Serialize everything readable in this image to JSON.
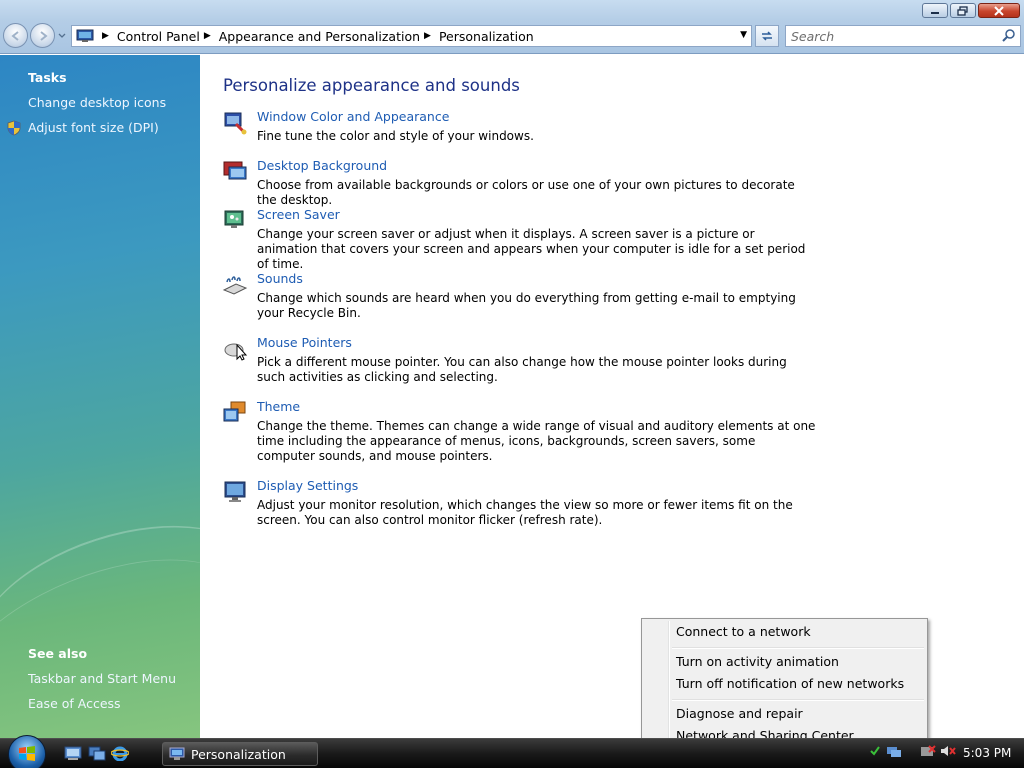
{
  "window": {
    "title": "Personalization"
  },
  "address_bar": {
    "breadcrumbs": [
      "Control Panel",
      "Appearance and Personalization",
      "Personalization"
    ]
  },
  "search": {
    "placeholder": "Search"
  },
  "sidebar": {
    "tasks_heading": "Tasks",
    "tasks": [
      "Change desktop icons",
      "Adjust font size (DPI)"
    ],
    "see_also_heading": "See also",
    "see_also": [
      "Taskbar and Start Menu",
      "Ease of Access"
    ]
  },
  "main": {
    "title": "Personalize appearance and sounds",
    "items": [
      {
        "icon": "window-color-icon",
        "link": "Window Color and Appearance",
        "desc": "Fine tune the color and style of your windows."
      },
      {
        "icon": "desktop-background-icon",
        "link": "Desktop Background",
        "desc": "Choose from available backgrounds or colors or use one of your own pictures to decorate the desktop."
      },
      {
        "icon": "screen-saver-icon",
        "link": "Screen Saver",
        "desc": "Change your screen saver or adjust when it displays. A screen saver is a picture or animation that covers your screen and appears when your computer is idle for a set period of time."
      },
      {
        "icon": "sounds-icon",
        "link": "Sounds",
        "desc": "Change which sounds are heard when you do everything from getting e-mail to emptying your Recycle Bin."
      },
      {
        "icon": "mouse-pointers-icon",
        "link": "Mouse Pointers",
        "desc": "Pick a different mouse pointer. You can also change how the mouse pointer looks during such activities as clicking and selecting."
      },
      {
        "icon": "theme-icon",
        "link": "Theme",
        "desc": "Change the theme. Themes can change a wide range of visual and auditory elements at one time including the appearance of menus, icons, backgrounds, screen savers, some computer sounds, and mouse pointers."
      },
      {
        "icon": "display-settings-icon",
        "link": "Display Settings",
        "desc": "Adjust your monitor resolution, which changes the view so more or fewer items fit on the screen. You can also control monitor flicker (refresh rate)."
      }
    ]
  },
  "context_menu": {
    "items": [
      "Connect to a network",
      "Turn on activity animation",
      "Turn off notification of new networks",
      "Diagnose and repair",
      "Network and Sharing Center"
    ]
  },
  "taskbar": {
    "task_label": "Personalization",
    "clock": "5:03 PM"
  },
  "colors": {
    "link": "#1e5cb3",
    "title": "#1e3287",
    "sidebar_top": "#2d86c4",
    "sidebar_bottom": "#86c57f"
  }
}
